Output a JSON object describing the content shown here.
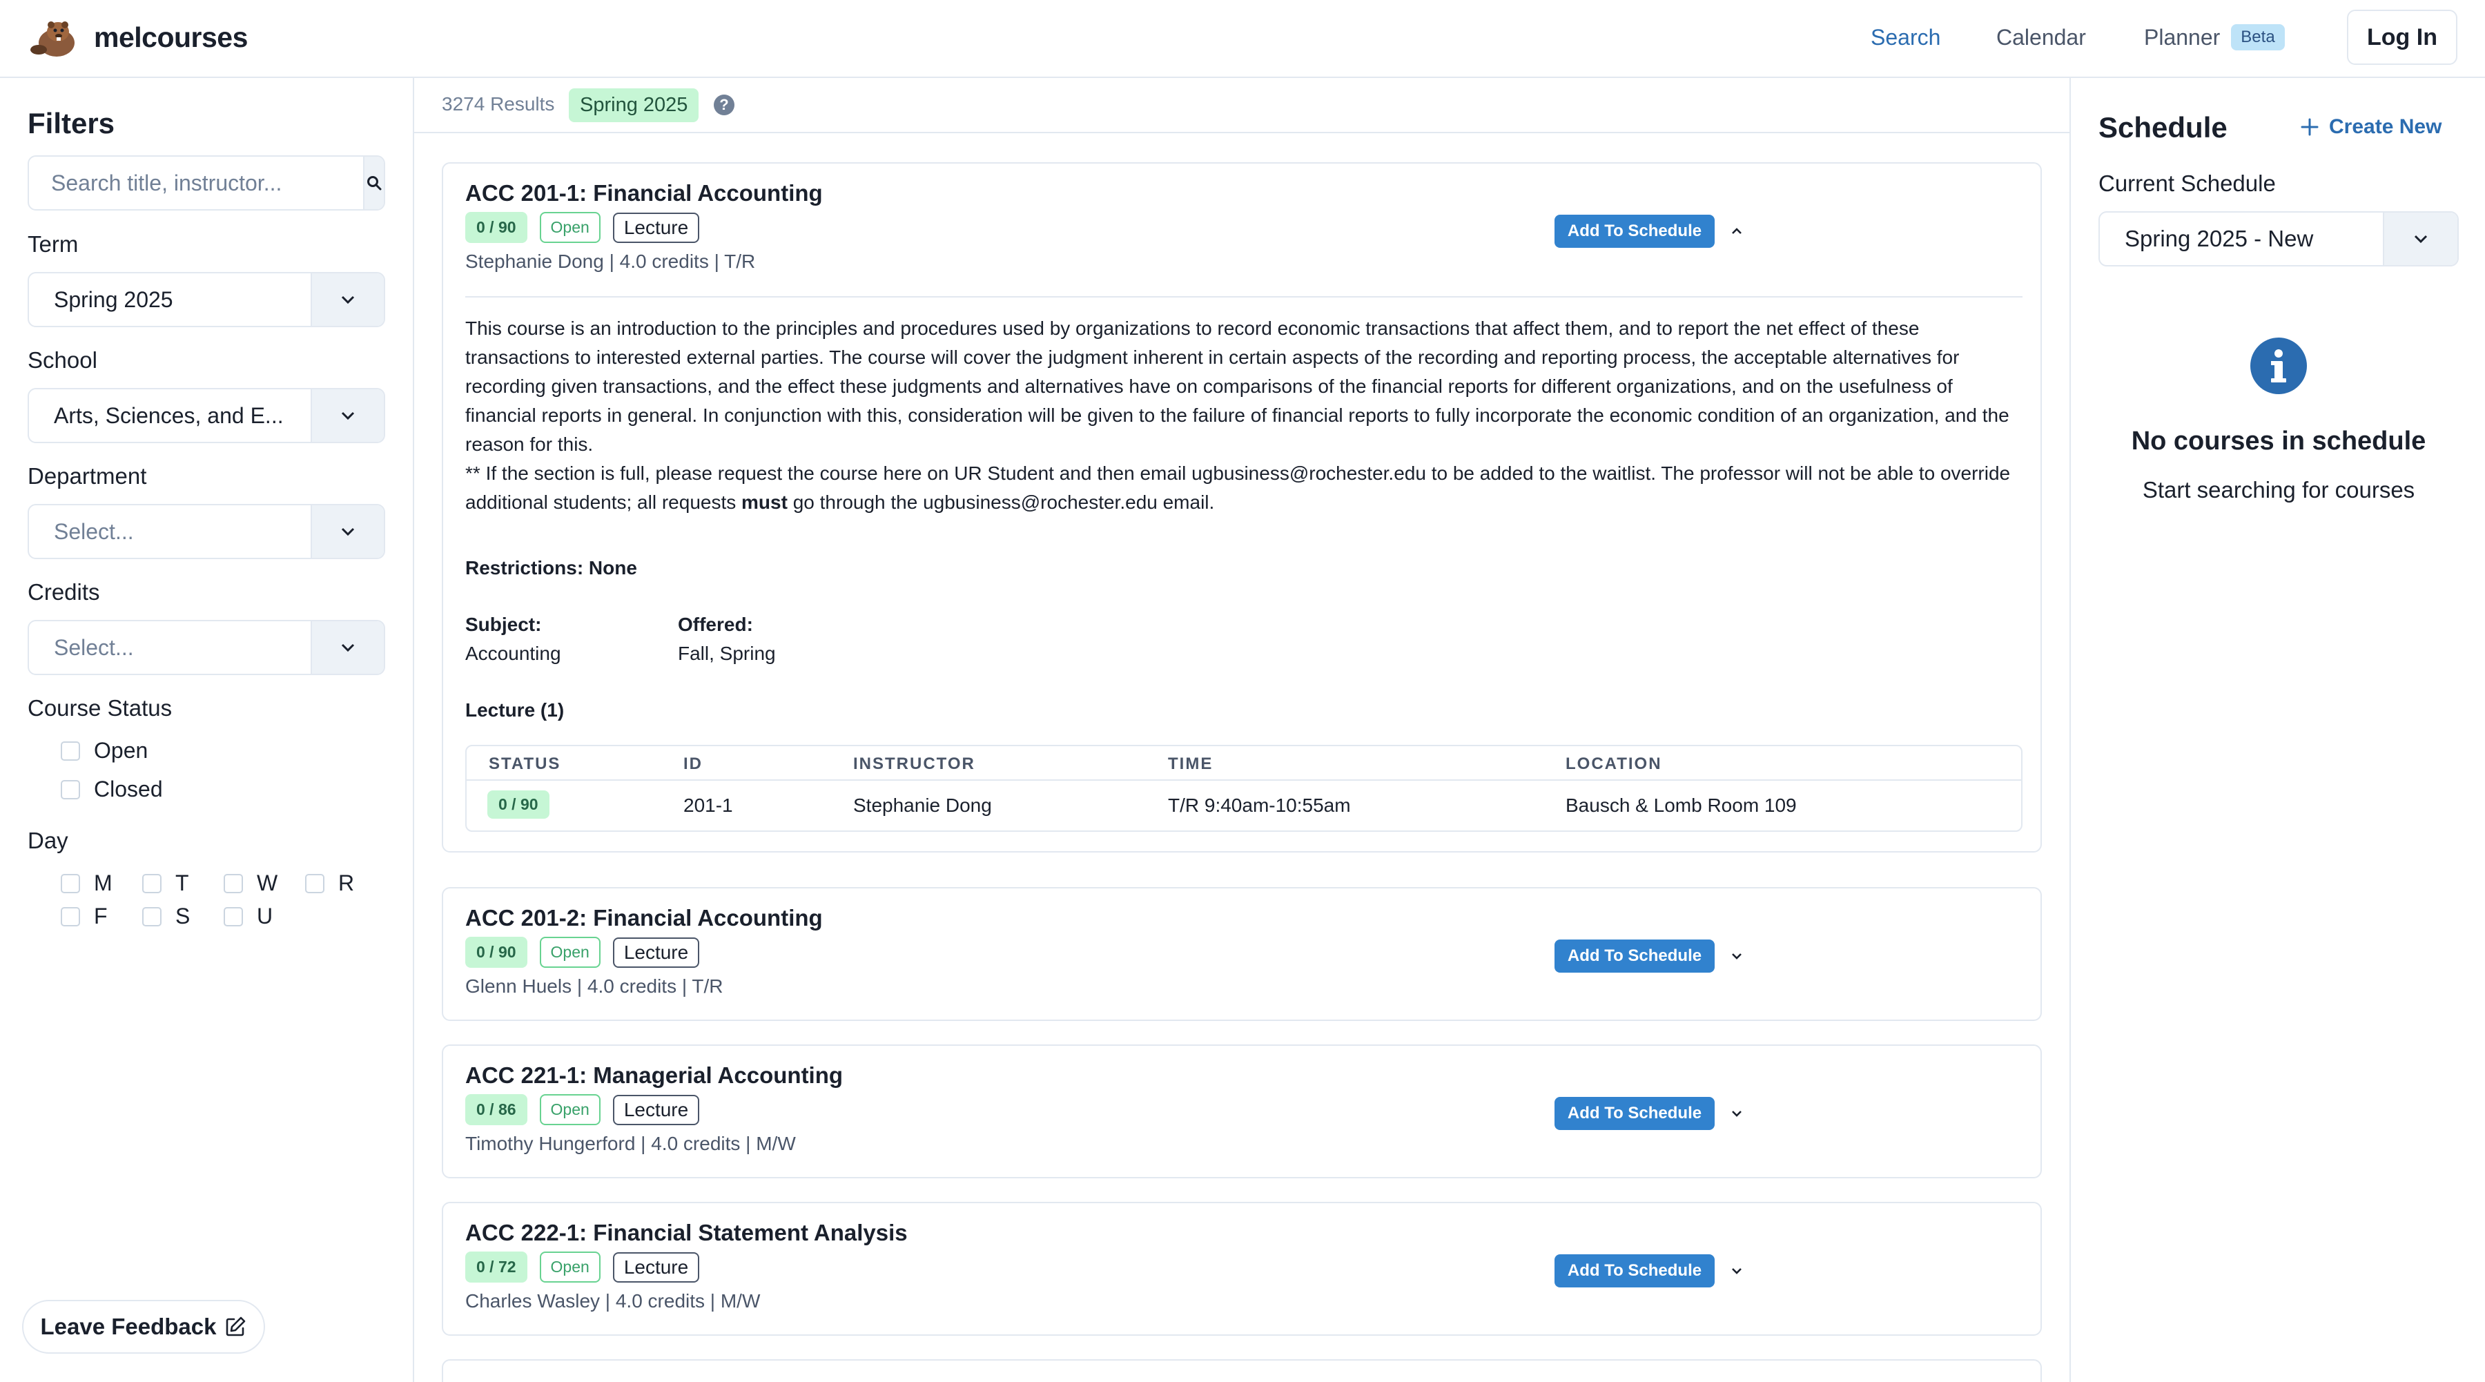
{
  "app": {
    "brand": "melcourses",
    "nav": {
      "search": "Search",
      "calendar": "Calendar",
      "planner": "Planner",
      "beta": "Beta",
      "login": "Log In"
    }
  },
  "sidebar": {
    "title": "Filters",
    "search_placeholder": "Search title, instructor...",
    "term": {
      "label": "Term",
      "value": "Spring 2025"
    },
    "school": {
      "label": "School",
      "value": "Arts, Sciences, and E..."
    },
    "department": {
      "label": "Department",
      "placeholder": "Select..."
    },
    "credits": {
      "label": "Credits",
      "placeholder": "Select..."
    },
    "course_status": {
      "label": "Course Status",
      "options": [
        "Open",
        "Closed"
      ]
    },
    "day": {
      "label": "Day",
      "options": [
        "M",
        "T",
        "W",
        "R",
        "F",
        "S",
        "U"
      ]
    },
    "feedback": "Leave Feedback"
  },
  "results": {
    "count": "3274 Results",
    "term": "Spring 2025",
    "help": "?"
  },
  "courses": [
    {
      "title": "ACC 201-1: Financial Accounting",
      "seats": "0 / 90",
      "status": "Open",
      "type": "Lecture",
      "meta": "Stephanie Dong | 4.0 credits | T/R",
      "add": "Add To Schedule",
      "expanded": true,
      "description_1": "This course is an introduction to the principles and procedures used by organizations to record economic transactions that affect them, and to report the net effect of these transactions to interested external parties. The course will cover the judgment inherent in certain aspects of the recording and reporting process, the acceptable alternatives for recording given transactions, and the effect these judgments and alternatives have on comparisons of the financial reports for different organizations, and on the usefulness of financial reports in general. In conjunction with this, consideration will be given to the failure of financial reports to fully incorporate the economic condition of an organization, and the reason for this.",
      "description_2a": "** If the section is full, please request the course here on UR Student and then email ugbusiness@rochester.edu to be added to the waitlist. The professor will not be able to override additional students; all requests ",
      "description_2b": "must",
      "description_2c": " go through the ugbusiness@rochester.edu email.",
      "restrictions": "Restrictions: None",
      "subject_label": "Subject:",
      "subject": "Accounting",
      "offered_label": "Offered:",
      "offered": "Fall, Spring",
      "section_header": "Lecture (1)",
      "table": {
        "headers": [
          "STATUS",
          "ID",
          "INSTRUCTOR",
          "TIME",
          "LOCATION"
        ],
        "row": {
          "status": "0 / 90",
          "id": "201-1",
          "instructor": "Stephanie Dong",
          "time": "T/R 9:40am-10:55am",
          "location": "Bausch & Lomb Room 109"
        }
      }
    },
    {
      "title": "ACC 201-2: Financial Accounting",
      "seats": "0 / 90",
      "status": "Open",
      "type": "Lecture",
      "meta": "Glenn Huels | 4.0 credits | T/R",
      "add": "Add To Schedule"
    },
    {
      "title": "ACC 221-1: Managerial Accounting",
      "seats": "0 / 86",
      "status": "Open",
      "type": "Lecture",
      "meta": "Timothy Hungerford | 4.0 credits | M/W",
      "add": "Add To Schedule"
    },
    {
      "title": "ACC 222-1: Financial Statement Analysis",
      "seats": "0 / 72",
      "status": "Open",
      "type": "Lecture",
      "meta": "Charles Wasley | 4.0 credits | M/W",
      "add": "Add To Schedule"
    }
  ],
  "schedule": {
    "title": "Schedule",
    "create_new": "Create New",
    "current_label": "Current Schedule",
    "current_value": "Spring 2025 - New",
    "empty_title": "No courses in schedule",
    "empty_subtitle": "Start searching for courses"
  },
  "colors": {
    "accent": "#3182ce",
    "link": "#2b6cb0",
    "green_bg": "#c6f6d5",
    "border": "#e2e8f0"
  }
}
